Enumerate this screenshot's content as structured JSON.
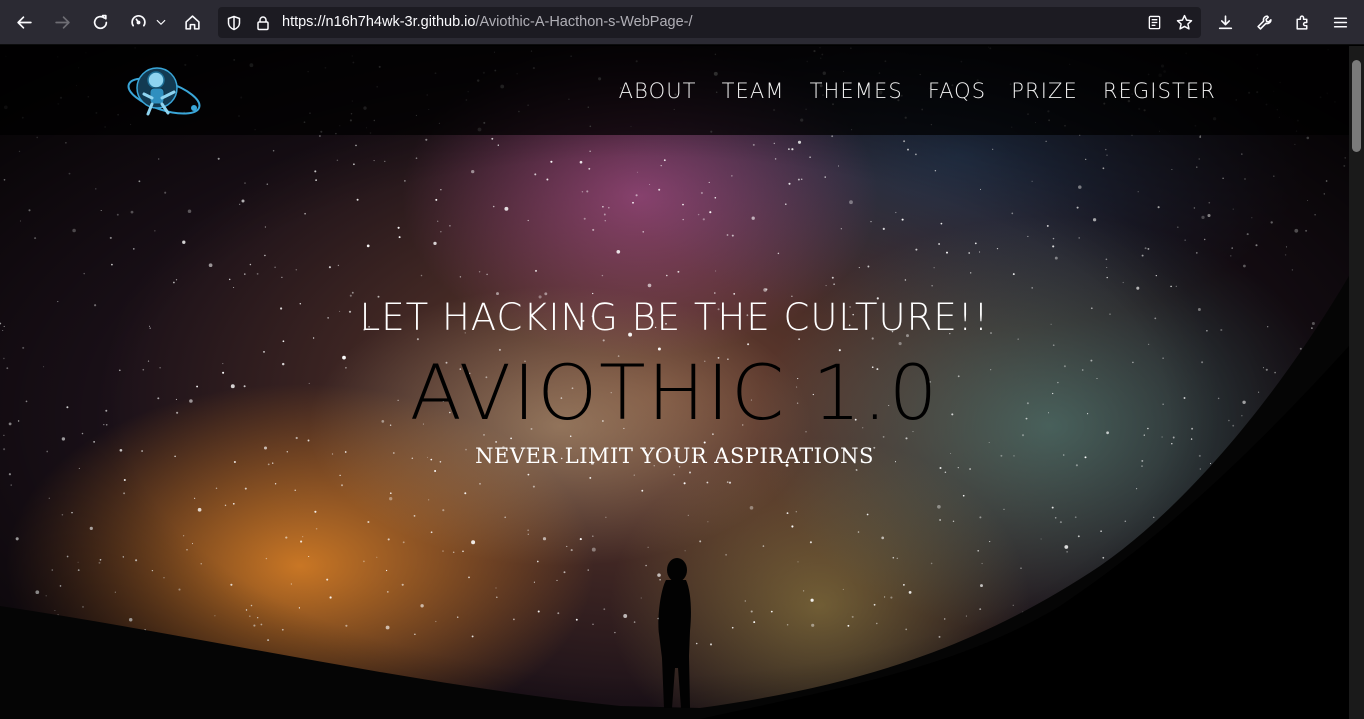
{
  "browser": {
    "url_host": "https://n16h7h4wk-3r.github.io",
    "url_path": "/Aviothic-A-Hacthon-s-WebPage-/",
    "icons": [
      "back-icon",
      "forward-icon",
      "reload-icon",
      "history-icon",
      "chevron-down-icon",
      "home-icon",
      "shield-icon",
      "lock-icon",
      "reader-mode-icon",
      "bookmark-star-icon",
      "download-icon",
      "wrench-icon",
      "extensions-icon",
      "menu-icon"
    ]
  },
  "nav": {
    "logo": "aviothic-logo",
    "links": [
      "ABOUT",
      "TEAM",
      "THEMES",
      "FAQS",
      "PRIZE",
      "REGISTER"
    ]
  },
  "hero": {
    "tagline": "LET HACKING BE THE CULTURE!!",
    "title": "AVIOTHIC 1.0",
    "subtitle": "NEVER LIMIT YOUR ASPIRATIONS"
  },
  "colors": {
    "toolbar_bg": "#2b2a33",
    "urlbar_bg": "#1c1b22",
    "nav_bg": "rgba(0,0,0,0.72)",
    "title_color": "#000000",
    "logo_accent": "#3aa6d8"
  }
}
